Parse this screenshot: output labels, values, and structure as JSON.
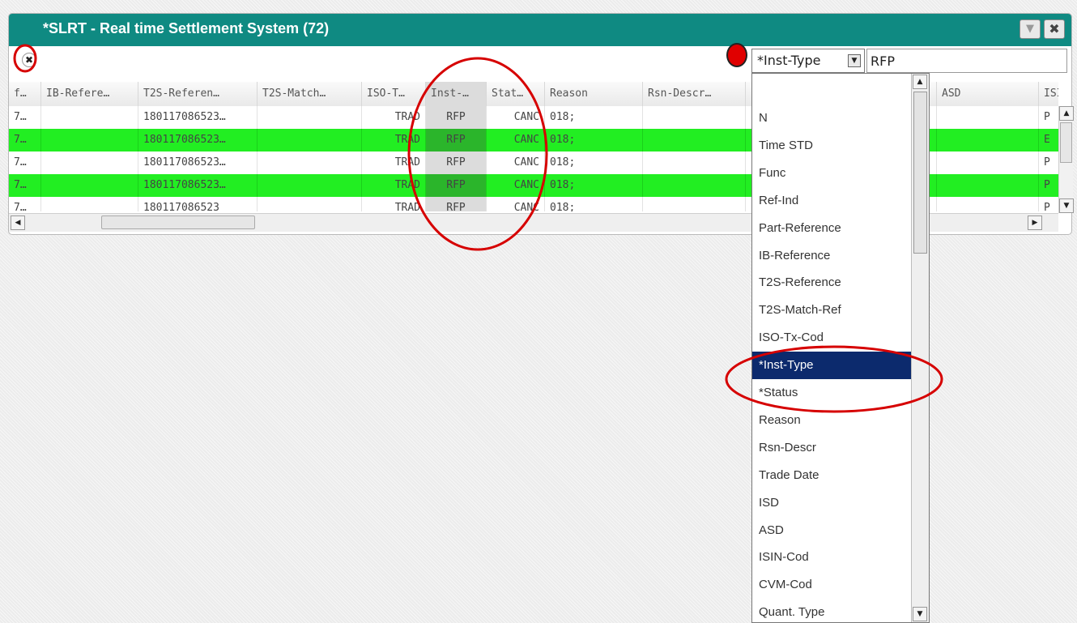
{
  "window": {
    "title": "*SLRT - Real time Settlement System (72)",
    "minimize_glyph": "▼",
    "close_glyph": "✖",
    "clear_glyph": "✖"
  },
  "filter": {
    "field_label": "*Inst-Type",
    "field_arrow": "▼",
    "value": "RFP"
  },
  "grid": {
    "columns": [
      "f…",
      "IB-Refere…",
      "T2S-Referen…",
      "T2S-Match…",
      "ISO-T…",
      "Inst-…",
      "Stat…",
      "Reason",
      "Rsn-Descr…",
      "",
      "ASD",
      "ISI"
    ],
    "rows": [
      {
        "color": "white",
        "cells": [
          "7…",
          "",
          "180117086523…",
          "",
          "TRAD",
          "RFP",
          "CANC",
          "018;",
          "",
          "",
          "",
          "P"
        ]
      },
      {
        "color": "green",
        "cells": [
          "7…",
          "",
          "180117086523…",
          "",
          "TRAD",
          "RFP",
          "CANC",
          "018;",
          "",
          "",
          "",
          "E"
        ]
      },
      {
        "color": "white",
        "cells": [
          "7…",
          "",
          "180117086523…",
          "",
          "TRAD",
          "RFP",
          "CANC",
          "018;",
          "",
          "",
          "",
          "P"
        ]
      },
      {
        "color": "green",
        "cells": [
          "7…",
          "",
          "180117086523…",
          "",
          "TRAD",
          "RFP",
          "CANC",
          "018;",
          "",
          "",
          "",
          "P"
        ]
      },
      {
        "color": "white",
        "cells": [
          "7…",
          "",
          "180117086523",
          "",
          "TRAD",
          "RFP",
          "CANC",
          "018;",
          "",
          "",
          "",
          "P"
        ]
      }
    ]
  },
  "dropdown": {
    "items": [
      "N",
      "Time STD",
      "Func",
      "Ref-Ind",
      "Part-Reference",
      "IB-Reference",
      "T2S-Reference",
      "T2S-Match-Ref",
      "ISO-Tx-Cod",
      "*Inst-Type",
      "*Status",
      "Reason",
      "Rsn-Descr",
      "Trade Date",
      "ISD",
      "ASD",
      "ISIN-Cod",
      "CVM-Cod",
      "Quant. Type"
    ],
    "selected_index": 9
  },
  "colors": {
    "title_bar": "#0f8a82",
    "row_highlight": "#22ee22",
    "selected_item": "#0c2a6d",
    "annotation": "#d60000"
  }
}
